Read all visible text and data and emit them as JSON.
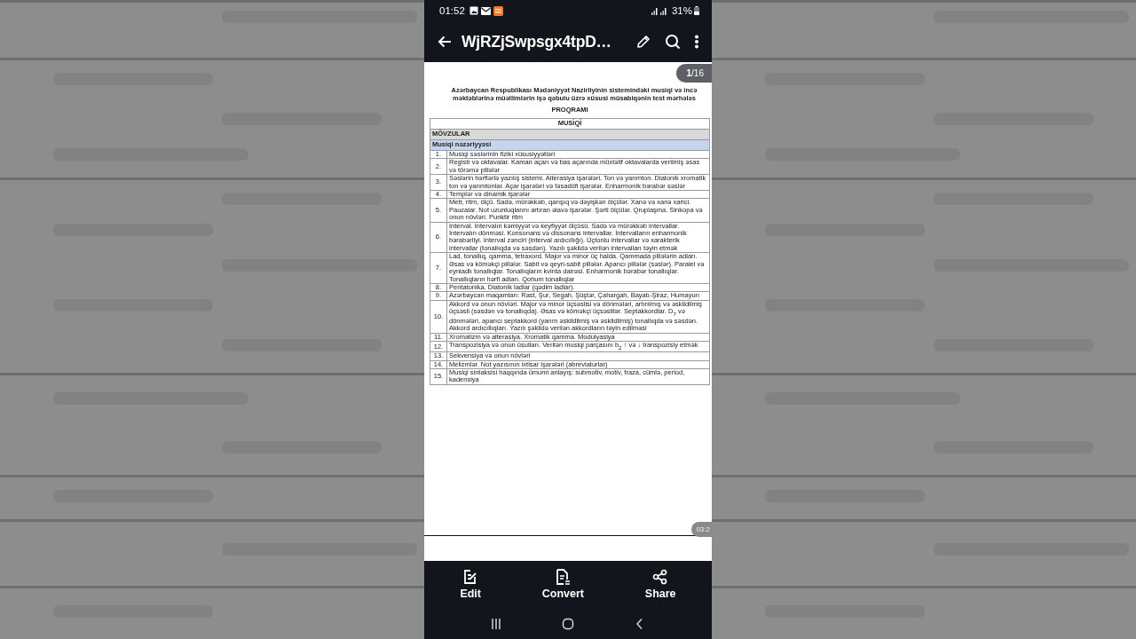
{
  "status_bar": {
    "time": "01:52",
    "battery": "31%"
  },
  "app_bar": {
    "title": "WjRZjSwpsgx4tpD…"
  },
  "page_badge": "**1**/16",
  "document": {
    "heading_lines": [
      "Azərbaycan Respublikası Mədəniyyət Nazirliyinin sistemindəki musiqi və incə",
      "məktəblərinə müəllimlərin işə qəbulu üzrə xüsusi müsabiqənin test mərhələs"
    ],
    "subtitle": "PROQRAMI",
    "table": {
      "title": "MUSİQİ",
      "section": "MÖVZULAR",
      "group": "Musiqi nəzəriyyəsi",
      "rows": [
        {
          "number": "1.",
          "text": "Musiqi səslərinin fiziki xüsusiyyətləri"
        },
        {
          "number": "2.",
          "text": "Registr və oktavalar. Kaman açarı və bas açarında müxtəlif oktavalarda verilmiş əsas və törəmə pillələr"
        },
        {
          "number": "3.",
          "text": "Səslərin hərflərlə yazılış sistemi. Alterasiya işarələri. Ton və yarımton. Diatonik xromatik ton və yarımtonlar. Açar işarələri və təsadüfi işarələr. Enharmonik bərabər səslər"
        },
        {
          "number": "4.",
          "text": "Templər və dinamik işarələr"
        },
        {
          "number": "5.",
          "text": "Metr, ritm, ölçü. Sadə, mürəkkəb, qarışıq və dəyişkən ölçülər. Xanə və xanə xarici. Pauzalar. Not uzunluqlarını artıran əlavə işarələr. Şərti ölçülər. Qruplaşma. Sinkopa və onun növləri. Punktir ritm"
        },
        {
          "number": "6.",
          "text": "İnterval. İntervalın kəmiyyət və keyfiyyət ölçüsü. Sadə və mürəkkəb intervallar. İntervalın dönməsi. Konsonans və dissonans intervallar. İntervalların enharmonik bərabərliyi. İnterval zənciri (interval ardıcıllığı). Üçtonlu intervallar və xarakterik intervallar (tonallıqda və səsdən). Yazılı şəkildə verilən intervalları təyin etmək"
        },
        {
          "number": "7.",
          "text": "Lad, tonallıq, qamma, tetraxord. Major və minor üç halda. Qammada pillələrin adları. Əsas və köməkçi pillələr. Sabit və qeyri-sabit pillələr. Aparıcı pillələr (səslər). Paralel və eyniadlı tonallıqlar. Tonallıqların kvinta dairəsi. Enharmonik bərabər tonallıqlar. Tonallıqların hərfi adları. Qohum tonallıqlar"
        },
        {
          "number": "8.",
          "text": "Pentatonika. Diatonik ladlar (qədim ladlar)."
        },
        {
          "number": "9.",
          "text": "Azərbaycan maqamları: Rast, Şur, Segah, Şüştər, Çahargah, Bayatı-Şiraz, Humayun"
        },
        {
          "number": "10.",
          "text": "Akkord və onun növləri. Major və minor üçsəslisi və dönmələri, artırılmış və əskildilmiş üçsəsli (səsdən və tonallıqda). Əsas və köməkçi üçsəslilər. Septakkordlar. D$_{7}$ və dönmələri, aparıcı septakkord (yarım əskildilmiş və əskildilmiş) tonallıqda və səsdən. Akkord ardıcıllıqları. Yazılı şəkildə verilən akkordların təyin edilməsi"
        },
        {
          "number": "11.",
          "text": "Xromatizm və alterasiya. Xromatik qamma. Modulyasiya"
        },
        {
          "number": "12.",
          "text": "Transpozisiya və onun üsulları. Verilən musiqi parçasını b$_{2}$ ↑ və ↓ transpozisiy etmək"
        },
        {
          "number": "13.",
          "text": "Sekvensiya və onun növləri"
        },
        {
          "number": "14.",
          "text": "Melizmlər. Not yazısının ixtisar işarələri (abreviaturlar)"
        },
        {
          "number": "15.",
          "text": "Musiqi sintaksisi haqqında ümumi anlayış: submotiv, motiv, fraza, cümlə, period, kadensiya"
        }
      ]
    }
  },
  "timer_badge": "03:2",
  "bottom_actions": [
    {
      "kind": "edit",
      "label": "Edit"
    },
    {
      "kind": "convert",
      "label": "Convert"
    },
    {
      "kind": "share",
      "label": "Share"
    }
  ]
}
